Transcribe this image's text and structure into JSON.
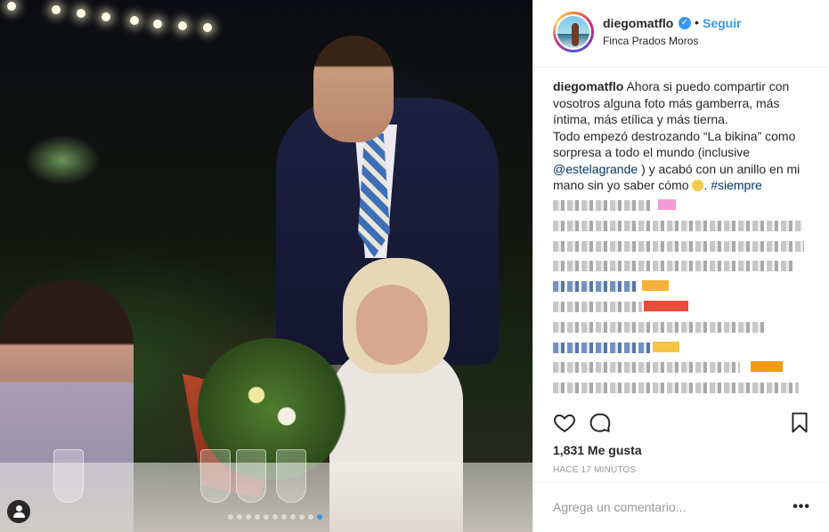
{
  "header": {
    "username": "diegomatflo",
    "follow_label": "Seguir",
    "separator": "•",
    "location": "Finca Prados Moros"
  },
  "caption": {
    "username": "diegomatflo",
    "text_1": "Ahora si puedo compartir con vosotros alguna foto más gamberra, más íntima, más etílica y más tierna.",
    "text_2": "Todo empezó destrozando “La bikina” como sorpresa a todo el mundo (inclusive",
    "mention": "@estelagrande",
    "text_3": ") y acabó con un anillo en mi mano sin yo saber cómo",
    "text_4": ".",
    "hashtag": "#siempre"
  },
  "actions": {
    "likes": "1,831 Me gusta",
    "time": "HACE 17 MINUTOS"
  },
  "comment_box": {
    "placeholder": "Agrega un comentario...",
    "more_label": "•••"
  },
  "colors": {
    "link": "#3897f0",
    "mention": "#003569",
    "border": "#efefef",
    "muted": "#999999"
  },
  "icons": [
    "user-tag-icon",
    "verified-badge-icon",
    "heart-icon",
    "comment-icon",
    "bookmark-icon",
    "more-options-icon"
  ],
  "carousel": {
    "total": 11,
    "active_index": 10
  }
}
